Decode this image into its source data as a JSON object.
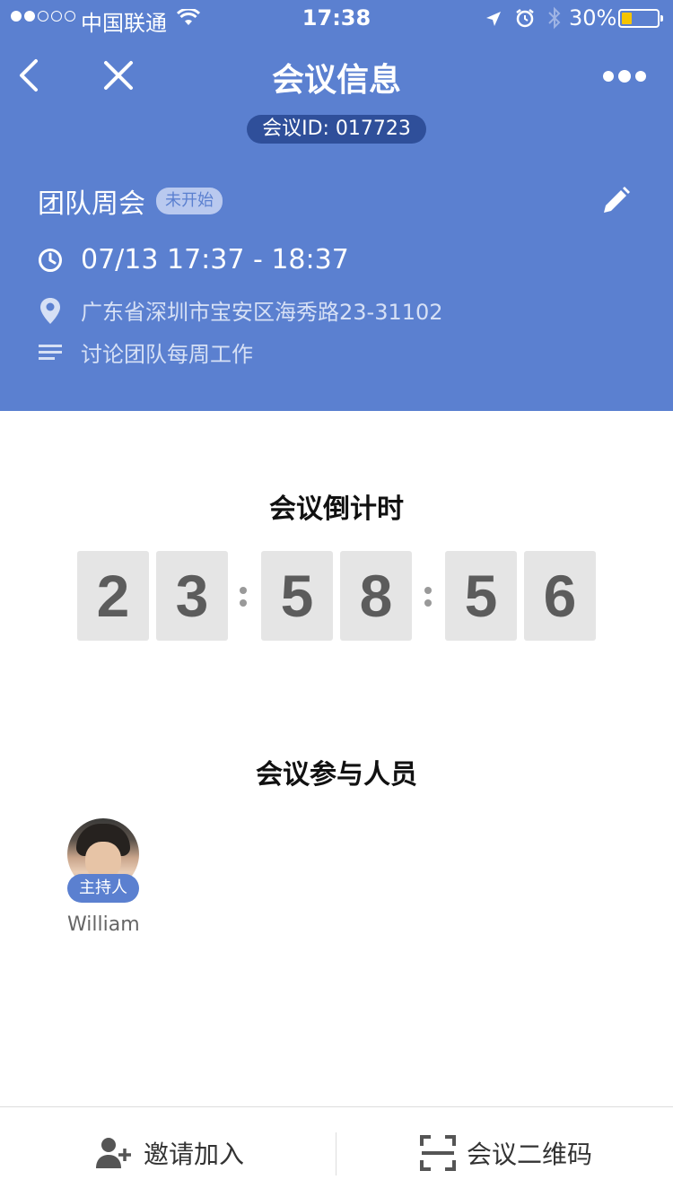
{
  "status_bar": {
    "carrier": "中国联通",
    "time": "17:38",
    "battery_percent": "30%",
    "signal_strength": 2,
    "signal_total": 5,
    "battery_level": 0.3,
    "battery_color": "#f5c400"
  },
  "nav": {
    "title": "会议信息",
    "back_icon": "chevron-left-icon",
    "close_icon": "close-icon",
    "more_icon": "more-icon"
  },
  "meeting": {
    "id_label": "会议ID: 017723",
    "name": "团队周会",
    "status": "未开始",
    "time": "07/13 17:37 - 18:37",
    "location": "广东省深圳市宝安区海秀路23-31102",
    "description": "讨论团队每周工作"
  },
  "countdown": {
    "title": "会议倒计时",
    "digits": [
      "2",
      "3",
      "5",
      "8",
      "5",
      "6"
    ]
  },
  "participants": {
    "title": "会议参与人员",
    "list": [
      {
        "name": "William",
        "role": "主持人"
      }
    ]
  },
  "bottom_bar": {
    "invite_label": "邀请加入",
    "qrcode_label": "会议二维码"
  },
  "colors": {
    "header_bg": "#5b80d0",
    "id_pill_bg": "#2f4f9a",
    "status_badge_bg": "#b9c9ef",
    "digit_bg": "#e5e5e5",
    "digit_text": "#5c5c5c",
    "host_badge_bg": "#5b80d0"
  }
}
